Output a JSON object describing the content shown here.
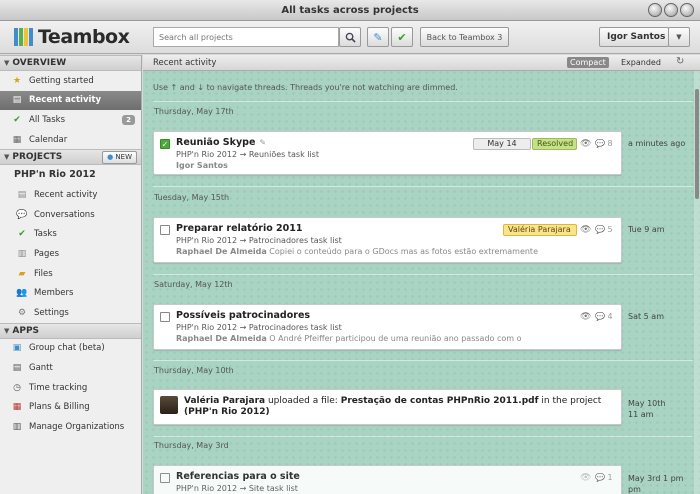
{
  "window": {
    "title": "All tasks across projects"
  },
  "header": {
    "logo_text": "Teambox",
    "search_placeholder": "Search all projects",
    "back_label": "Back to Teambox 3",
    "user_name": "Igor Santos"
  },
  "sidebar": {
    "overview_label": "OVERVIEW",
    "overview_items": [
      {
        "label": "Getting started",
        "icon": "star-icon"
      },
      {
        "label": "Recent activity",
        "icon": "document-icon"
      },
      {
        "label": "All Tasks",
        "icon": "check-icon",
        "badge": "2"
      },
      {
        "label": "Calendar",
        "icon": "calendar-icon"
      }
    ],
    "projects_label": "PROJECTS",
    "new_label": "NEW",
    "project_name": "PHP'n Rio 2012",
    "project_items": [
      {
        "label": "Recent activity",
        "icon": "document-icon"
      },
      {
        "label": "Conversations",
        "icon": "speech-bubble-icon"
      },
      {
        "label": "Tasks",
        "icon": "check-icon"
      },
      {
        "label": "Pages",
        "icon": "page-icon"
      },
      {
        "label": "Files",
        "icon": "folder-icon"
      },
      {
        "label": "Members",
        "icon": "people-icon"
      },
      {
        "label": "Settings",
        "icon": "gear-icon"
      }
    ],
    "apps_label": "APPS",
    "app_items": [
      {
        "label": "Group chat (beta)",
        "icon": "chat-icon"
      },
      {
        "label": "Gantt",
        "icon": "gantt-icon"
      },
      {
        "label": "Time tracking",
        "icon": "clock-icon"
      },
      {
        "label": "Plans & Billing",
        "icon": "building-icon"
      },
      {
        "label": "Manage Organizations",
        "icon": "organization-icon"
      }
    ]
  },
  "main": {
    "title": "Recent activity",
    "compact_label": "Compact",
    "expanded_label": "Expanded",
    "hint": "Use ↑ and ↓ to navigate threads. Threads you're not watching are dimmed.",
    "dates": [
      "Thursday, May 17th",
      "Tuesday, May 15th",
      "Saturday, May 12th",
      "Thursday, May 10th",
      "Thursday, May 3rd"
    ],
    "cards": [
      {
        "title": "Reunião Skype",
        "path": "PHP'n Rio 2012 → Reuniões task list",
        "author": "Igor Santos",
        "excerpt": "",
        "due": "May 14",
        "status": "Resolved",
        "comments": "8",
        "time": "a minutes ago"
      },
      {
        "title": "Preparar relatório 2011",
        "path": "PHP'n Rio 2012 → Patrocinadores task list",
        "author": "Raphael De Almeida",
        "excerpt": "Copiei o conteúdo para o GDocs mas as fotos estão extremamente",
        "assignee": "Valéria Parajara",
        "comments": "5",
        "time": "Tue 9 am"
      },
      {
        "title": "Possíveis patrocinadores",
        "path": "PHP'n Rio 2012 → Patrocinadores task list",
        "author": "Raphael De Almeida",
        "excerpt": "O André Pfeiffer participou de uma reunião ano passado com o",
        "comments": "4",
        "time": "Sat 5 am"
      },
      {
        "user": "Valéria Parajara",
        "action": "uploaded a file:",
        "file": "Prestação de contas PHPnRio 2011.pdf",
        "in_project": "in the project",
        "project": "(PHP'n Rio 2012)",
        "time_line1": "May 10th",
        "time_line2": "11 am"
      },
      {
        "title": "Referencias para o site",
        "path": "PHP'n Rio 2012 → Site task list",
        "comments": "1",
        "time_line1": "May 3rd 1 pm",
        "time_line2": "pm"
      }
    ]
  },
  "colors": {
    "accent_green": "#4caa3a",
    "resolved_bg": "#c6e08a",
    "assignee_bg": "#fbe38c",
    "background": "#a9d3c3"
  }
}
